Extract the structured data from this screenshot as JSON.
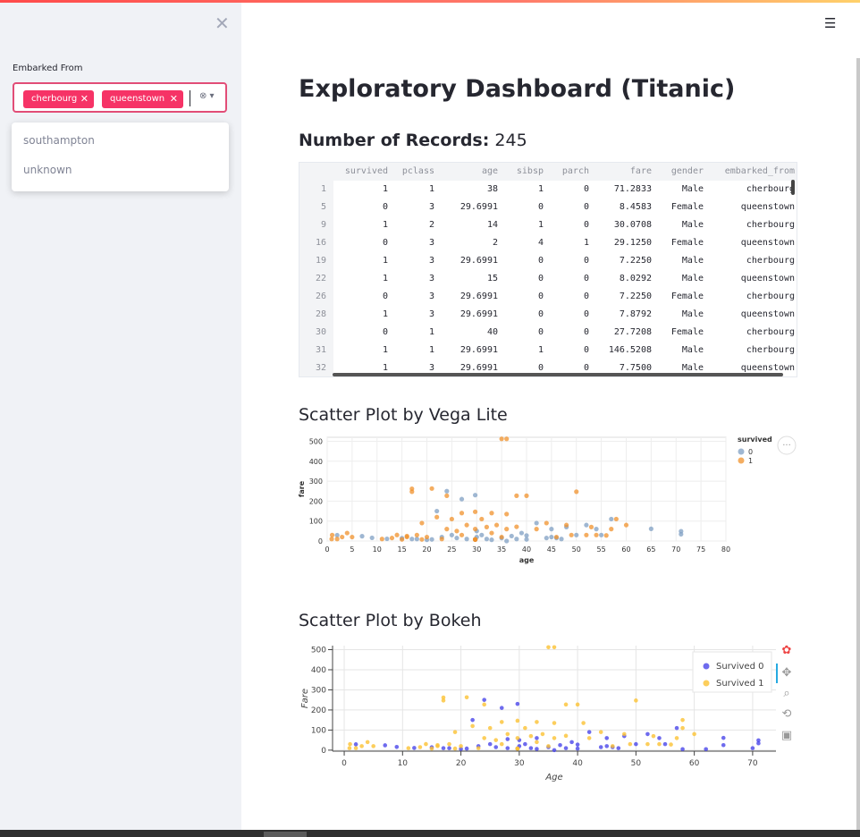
{
  "sidebar": {
    "close_icon": "close-icon",
    "filter_label": "Embarked From",
    "selected_chips": [
      {
        "label": "cherbourg",
        "remove": "✕"
      },
      {
        "label": "queenstown",
        "remove": "✕"
      }
    ],
    "dropdown_options": [
      "southampton",
      "unknown"
    ]
  },
  "header": {
    "menu_icon": "hamburger-menu-icon"
  },
  "main": {
    "title": "Exploratory Dashboard (Titanic)",
    "records_label": "Number of Records:",
    "records_count": "245",
    "table": {
      "columns": [
        "survived",
        "pclass",
        "age",
        "sibsp",
        "parch",
        "fare",
        "gender",
        "embarked_from"
      ],
      "rows": [
        [
          "1",
          "1",
          "1",
          "38",
          "1",
          "0",
          "71.2833",
          "Male",
          "cherbourg"
        ],
        [
          "5",
          "0",
          "3",
          "29.6991",
          "0",
          "0",
          "8.4583",
          "Female",
          "queenstown"
        ],
        [
          "9",
          "1",
          "2",
          "14",
          "1",
          "0",
          "30.0708",
          "Male",
          "cherbourg"
        ],
        [
          "16",
          "0",
          "3",
          "2",
          "4",
          "1",
          "29.1250",
          "Female",
          "queenstown"
        ],
        [
          "19",
          "1",
          "3",
          "29.6991",
          "0",
          "0",
          "7.2250",
          "Male",
          "cherbourg"
        ],
        [
          "22",
          "1",
          "3",
          "15",
          "0",
          "0",
          "8.0292",
          "Male",
          "queenstown"
        ],
        [
          "26",
          "0",
          "3",
          "29.6991",
          "0",
          "0",
          "7.2250",
          "Female",
          "cherbourg"
        ],
        [
          "28",
          "1",
          "3",
          "29.6991",
          "0",
          "0",
          "7.8792",
          "Male",
          "queenstown"
        ],
        [
          "30",
          "0",
          "1",
          "40",
          "0",
          "0",
          "27.7208",
          "Female",
          "cherbourg"
        ],
        [
          "31",
          "1",
          "1",
          "29.6991",
          "1",
          "0",
          "146.5208",
          "Male",
          "cherbourg"
        ],
        [
          "32",
          "1",
          "3",
          "29.6991",
          "0",
          "0",
          "7.7500",
          "Male",
          "queenstown"
        ]
      ]
    },
    "vega_title": "Scatter Plot by Vega Lite",
    "bokeh_title": "Scatter Plot by Bokeh"
  },
  "colors": {
    "accent": "#f63366",
    "vega_0": "#7f9fc3",
    "vega_1": "#f0922c",
    "bokeh_0": "#4a46ea",
    "bokeh_1": "#fbc233"
  },
  "chart_data": [
    {
      "type": "scatter",
      "title": "",
      "xlabel": "age",
      "ylabel": "fare",
      "xlim": [
        0,
        80
      ],
      "ylim": [
        0,
        520
      ],
      "xticks": [
        "0",
        "5",
        "10",
        "15",
        "20",
        "25",
        "30",
        "35",
        "40",
        "45",
        "50",
        "55",
        "60",
        "65",
        "70",
        "75",
        "80"
      ],
      "yticks": [
        "0",
        "100",
        "200",
        "300",
        "400",
        "500"
      ],
      "grid": true,
      "legend": {
        "title": "survived",
        "entries": [
          "0",
          "1"
        ],
        "placement": "top-right"
      },
      "series": [
        {
          "name": "0",
          "points": [
            [
              40,
              27.7
            ],
            [
              29.7,
              7.2
            ],
            [
              2,
              29.1
            ],
            [
              29.7,
              8.5
            ],
            [
              45,
              20
            ],
            [
              71,
              34
            ],
            [
              71,
              49
            ],
            [
              65,
              61
            ],
            [
              54,
              60
            ],
            [
              50,
              30
            ],
            [
              47,
              10
            ],
            [
              44,
              15
            ],
            [
              40,
              8
            ],
            [
              37,
              25
            ],
            [
              35,
              15
            ],
            [
              33,
              6
            ],
            [
              32,
              10
            ],
            [
              30,
              20
            ],
            [
              30,
              50
            ],
            [
              28,
              10
            ],
            [
              27,
              210
            ],
            [
              26,
              15
            ],
            [
              25,
              30
            ],
            [
              24,
              250
            ],
            [
              23,
              20
            ],
            [
              22,
              150
            ],
            [
              21,
              8
            ],
            [
              20,
              6
            ],
            [
              18,
              10
            ],
            [
              17,
              10
            ],
            [
              15,
              14
            ],
            [
              12,
              11
            ],
            [
              9,
              16
            ],
            [
              7,
              24
            ],
            [
              52,
              80
            ],
            [
              57,
              110
            ],
            [
              45,
              60
            ],
            [
              36,
              0
            ],
            [
              38,
              10
            ],
            [
              39,
              40
            ],
            [
              29.7,
              230
            ],
            [
              31,
              30
            ],
            [
              42,
              90
            ],
            [
              46,
              15
            ],
            [
              48,
              70
            ],
            [
              55,
              30
            ]
          ]
        },
        {
          "name": "1",
          "points": [
            [
              38,
              71.3
            ],
            [
              14,
              30.1
            ],
            [
              29.7,
              7.2
            ],
            [
              15,
              8
            ],
            [
              29.7,
              7.9
            ],
            [
              29.7,
              146.5
            ],
            [
              29.7,
              7.8
            ],
            [
              35,
              512
            ],
            [
              36,
              512
            ],
            [
              50,
              247
            ],
            [
              17,
              262
            ],
            [
              17,
              247
            ],
            [
              21,
              263
            ],
            [
              24,
              227
            ],
            [
              38,
              227
            ],
            [
              40,
              227
            ],
            [
              19,
              90
            ],
            [
              25,
              110
            ],
            [
              22,
              120
            ],
            [
              34,
              80
            ],
            [
              36,
              135
            ],
            [
              31,
              110
            ],
            [
              29.7,
              60
            ],
            [
              28,
              80
            ],
            [
              42,
              60
            ],
            [
              48,
              80
            ],
            [
              52,
              30
            ],
            [
              58,
              110
            ],
            [
              36,
              60
            ],
            [
              60,
              80
            ],
            [
              56,
              28
            ],
            [
              35,
              20
            ],
            [
              33,
              40
            ],
            [
              27,
              30
            ],
            [
              23,
              10
            ],
            [
              20,
              20
            ],
            [
              19,
              8
            ],
            [
              16,
              20
            ],
            [
              1,
              30
            ],
            [
              3,
              20
            ],
            [
              4,
              40
            ],
            [
              0.9,
              10
            ],
            [
              18,
              30
            ],
            [
              26,
              50
            ],
            [
              32,
              70
            ],
            [
              44,
              90
            ],
            [
              46,
              20
            ],
            [
              53,
              70
            ],
            [
              54,
              30
            ],
            [
              57,
              60
            ],
            [
              2,
              10
            ],
            [
              5,
              20
            ],
            [
              24,
              60
            ],
            [
              27,
              140
            ],
            [
              33,
              140
            ],
            [
              49,
              30
            ],
            [
              16,
              25
            ],
            [
              13,
              15
            ],
            [
              11,
              10
            ]
          ]
        }
      ]
    },
    {
      "type": "scatter",
      "title": "",
      "xlabel": "Age",
      "ylabel": "Fare",
      "xlim": [
        -2,
        74
      ],
      "ylim": [
        -5,
        520
      ],
      "xticks": [
        "0",
        "10",
        "20",
        "30",
        "40",
        "50",
        "60",
        "70"
      ],
      "yticks": [
        "0",
        "100",
        "200",
        "300",
        "400",
        "500"
      ],
      "grid": true,
      "legend": {
        "entries": [
          "Survived 0",
          "Survived 1"
        ],
        "placement": "top-right"
      },
      "series": [
        {
          "name": "Survived 0",
          "points": [
            [
              40,
              27.7
            ],
            [
              29.7,
              7.2
            ],
            [
              2,
              29.1
            ],
            [
              29.7,
              8.5
            ],
            [
              45,
              20
            ],
            [
              71,
              34
            ],
            [
              71,
              49
            ],
            [
              65,
              61
            ],
            [
              54,
              60
            ],
            [
              50,
              30
            ],
            [
              47,
              10
            ],
            [
              44,
              15
            ],
            [
              40,
              8
            ],
            [
              37,
              25
            ],
            [
              35,
              15
            ],
            [
              33,
              6
            ],
            [
              32,
              10
            ],
            [
              30,
              20
            ],
            [
              30,
              50
            ],
            [
              28,
              10
            ],
            [
              27,
              210
            ],
            [
              26,
              15
            ],
            [
              25,
              30
            ],
            [
              24,
              250
            ],
            [
              23,
              20
            ],
            [
              22,
              150
            ],
            [
              21,
              8
            ],
            [
              20,
              6
            ],
            [
              18,
              10
            ],
            [
              17,
              10
            ],
            [
              15,
              14
            ],
            [
              12,
              11
            ],
            [
              9,
              16
            ],
            [
              7,
              24
            ],
            [
              52,
              80
            ],
            [
              57,
              110
            ],
            [
              45,
              60
            ],
            [
              36,
              0
            ],
            [
              38,
              10
            ],
            [
              39,
              40
            ],
            [
              29.7,
              230
            ],
            [
              31,
              30
            ],
            [
              42,
              90
            ],
            [
              46,
              15
            ],
            [
              48,
              70
            ],
            [
              55,
              30
            ],
            [
              62,
              5
            ],
            [
              70,
              10
            ],
            [
              65,
              25
            ],
            [
              58,
              5
            ],
            [
              33,
              60
            ],
            [
              28,
              55
            ]
          ]
        },
        {
          "name": "Survived 1",
          "points": [
            [
              38,
              71.3
            ],
            [
              14,
              30.1
            ],
            [
              29.7,
              7.2
            ],
            [
              15,
              8
            ],
            [
              29.7,
              7.9
            ],
            [
              29.7,
              146.5
            ],
            [
              29.7,
              7.8
            ],
            [
              35,
              512
            ],
            [
              36,
              512
            ],
            [
              50,
              247
            ],
            [
              17,
              262
            ],
            [
              17,
              247
            ],
            [
              21,
              263
            ],
            [
              24,
              227
            ],
            [
              38,
              227
            ],
            [
              40,
              227
            ],
            [
              19,
              90
            ],
            [
              25,
              110
            ],
            [
              22,
              120
            ],
            [
              34,
              80
            ],
            [
              36,
              135
            ],
            [
              31,
              110
            ],
            [
              29.7,
              60
            ],
            [
              28,
              80
            ],
            [
              42,
              60
            ],
            [
              48,
              80
            ],
            [
              52,
              30
            ],
            [
              58,
              110
            ],
            [
              36,
              60
            ],
            [
              60,
              80
            ],
            [
              56,
              28
            ],
            [
              35,
              20
            ],
            [
              33,
              40
            ],
            [
              27,
              30
            ],
            [
              23,
              10
            ],
            [
              20,
              20
            ],
            [
              19,
              8
            ],
            [
              16,
              20
            ],
            [
              1,
              30
            ],
            [
              3,
              20
            ],
            [
              4,
              40
            ],
            [
              0.9,
              10
            ],
            [
              18,
              30
            ],
            [
              26,
              50
            ],
            [
              32,
              70
            ],
            [
              44,
              90
            ],
            [
              46,
              20
            ],
            [
              53,
              70
            ],
            [
              54,
              30
            ],
            [
              57,
              60
            ],
            [
              2,
              10
            ],
            [
              5,
              20
            ],
            [
              24,
              60
            ],
            [
              27,
              140
            ],
            [
              33,
              140
            ],
            [
              49,
              30
            ],
            [
              16,
              25
            ],
            [
              13,
              15
            ],
            [
              11,
              10
            ],
            [
              41,
              135
            ],
            [
              58,
              150
            ]
          ]
        }
      ]
    }
  ]
}
